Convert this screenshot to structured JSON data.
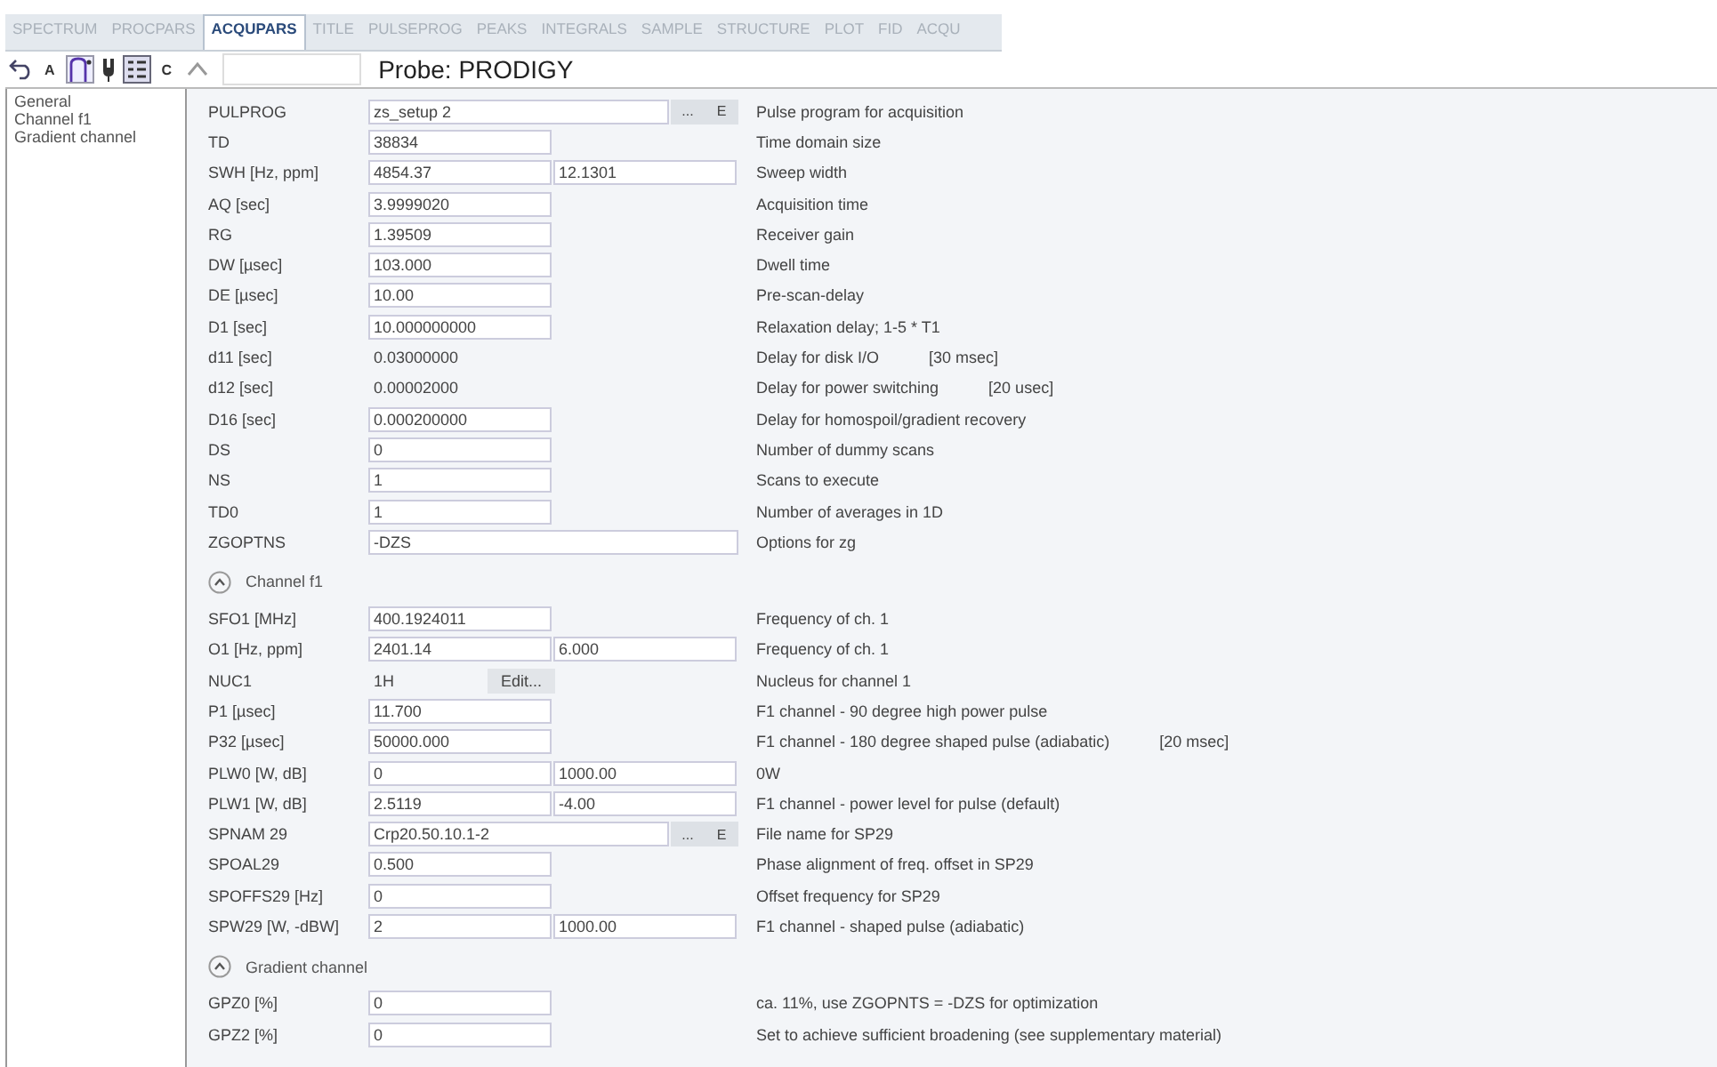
{
  "tabs": [
    {
      "label": "SPECTRUM",
      "selected": false
    },
    {
      "label": "PROCPARS",
      "selected": false
    },
    {
      "label": "ACQUPARS",
      "selected": true
    },
    {
      "label": "TITLE",
      "selected": false
    },
    {
      "label": "PULSEPROG",
      "selected": false
    },
    {
      "label": "PEAKS",
      "selected": false
    },
    {
      "label": "INTEGRALS",
      "selected": false
    },
    {
      "label": "SAMPLE",
      "selected": false
    },
    {
      "label": "STRUCTURE",
      "selected": false
    },
    {
      "label": "PLOT",
      "selected": false
    },
    {
      "label": "FID",
      "selected": false
    },
    {
      "label": "ACQU",
      "selected": false
    }
  ],
  "toolbar": {
    "text_buttons": [
      "A",
      "C"
    ],
    "probe": "Probe: PRODIGY"
  },
  "sidebar": {
    "items": [
      "General",
      "Channel f1",
      "Gradient channel"
    ]
  },
  "sections": [
    {
      "rows": [
        {
          "kind": "file",
          "label": "PULPROG",
          "value": "zs_setup 2",
          "browse": "...",
          "edit": "E",
          "description": "Pulse program for acquisition"
        },
        {
          "kind": "field",
          "label": "TD",
          "value": "38834",
          "description": "Time domain size"
        },
        {
          "kind": "field",
          "label": "SWH [Hz, ppm]",
          "value": "4854.37",
          "value2": "12.1301",
          "description": "Sweep width"
        },
        {
          "kind": "field",
          "label": "AQ [sec]",
          "value": "3.9999020",
          "description": "Acquisition time"
        },
        {
          "kind": "field",
          "label": "RG",
          "value": "1.39509",
          "description": "Receiver gain"
        },
        {
          "kind": "field",
          "label": "DW [µsec]",
          "value": "103.000",
          "description": "Dwell time"
        },
        {
          "kind": "field",
          "label": "DE [µsec]",
          "value": "10.00",
          "description": "Pre-scan-delay"
        },
        {
          "kind": "field",
          "label": "D1 [sec]",
          "value": "10.000000000",
          "description": "Relaxation delay; 1-5 * T1"
        },
        {
          "kind": "text",
          "label": "d11 [sec]",
          "value": "0.03000000",
          "description": "Delay for disk I/O",
          "note": "[30 msec]"
        },
        {
          "kind": "text",
          "label": "d12 [sec]",
          "value": "0.00002000",
          "description": "Delay for power switching",
          "note": "[20 usec]"
        },
        {
          "kind": "field",
          "label": "D16 [sec]",
          "value": "0.000200000",
          "description": "Delay for homospoil/gradient recovery"
        },
        {
          "kind": "field",
          "label": "DS",
          "value": "0",
          "description": "Number of dummy scans"
        },
        {
          "kind": "field",
          "label": "NS",
          "value": "1",
          "description": "Scans to execute"
        },
        {
          "kind": "field",
          "label": "TD0",
          "value": "1",
          "description": "Number of averages in 1D"
        },
        {
          "kind": "wide",
          "label": "ZGOPTNS",
          "value": "-DZS",
          "description": "Options for zg"
        }
      ]
    },
    {
      "title": "Channel f1",
      "rows": [
        {
          "kind": "field",
          "label": "SFO1 [MHz]",
          "value": "400.1924011",
          "description": "Frequency of ch. 1"
        },
        {
          "kind": "field",
          "label": "O1 [Hz, ppm]",
          "value": "2401.14",
          "value2": "6.000",
          "description": "Frequency of ch. 1"
        },
        {
          "kind": "nucleus",
          "label": "NUC1",
          "value": "1H",
          "edit": "Edit...",
          "description": "Nucleus for channel 1"
        },
        {
          "kind": "field",
          "label": "P1 [µsec]",
          "value": "11.700",
          "description": "F1 channel -  90 degree high power pulse"
        },
        {
          "kind": "field",
          "label": "P32 [µsec]",
          "value": "50000.000",
          "description": "F1 channel - 180 degree shaped pulse (adiabatic)",
          "note": "[20 msec]"
        },
        {
          "kind": "field",
          "label": "PLW0 [W, dB]",
          "value": "0",
          "value2": "1000.00",
          "description": "0W"
        },
        {
          "kind": "field",
          "label": "PLW1 [W, dB]",
          "value": "2.5119",
          "value2": "-4.00",
          "description": "F1 channel - power level for pulse (default)"
        },
        {
          "kind": "file",
          "label": "SPNAM 29",
          "value": "Crp20.50.10.1-2",
          "browse": "...",
          "edit": "E",
          "description": "File name for SP29"
        },
        {
          "kind": "field",
          "label": "SPOAL29",
          "value": "0.500",
          "description": "Phase alignment of freq. offset in SP29"
        },
        {
          "kind": "field",
          "label": "SPOFFS29 [Hz]",
          "value": "0",
          "description": "Offset frequency for SP29"
        },
        {
          "kind": "field",
          "label": "SPW29 [W, -dBW]",
          "value": "2",
          "value2": "1000.00",
          "description": "F1 channel - shaped pulse (adiabatic)"
        }
      ]
    },
    {
      "title": "Gradient channel",
      "rows": [
        {
          "kind": "field",
          "label": "GPZ0 [%]",
          "value": "0",
          "description": "ca. 11%, use ZGOPNTS = -DZS for optimization"
        },
        {
          "kind": "field",
          "label": "GPZ2 [%]",
          "value": "0",
          "description": "Set to achieve sufficient broadening (see supplementary material)"
        }
      ]
    }
  ]
}
